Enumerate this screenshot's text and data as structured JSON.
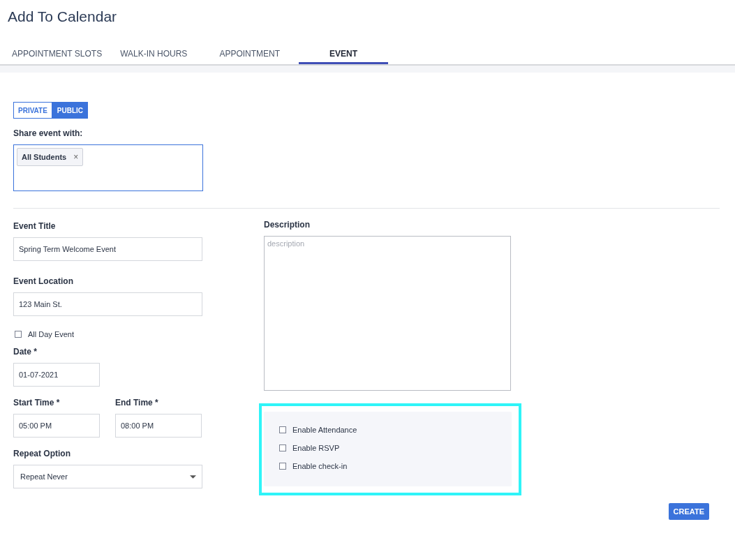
{
  "page_title": "Add To Calendar",
  "tabs": [
    {
      "label": "APPOINTMENT SLOTS",
      "selected": false
    },
    {
      "label": "WALK-IN HOURS",
      "selected": false
    },
    {
      "label": "APPOINTMENT",
      "selected": false
    },
    {
      "label": "EVENT",
      "selected": true
    }
  ],
  "visibility": [
    {
      "label": "PRIVATE",
      "selected": false
    },
    {
      "label": "PUBLIC",
      "selected": true
    }
  ],
  "share": {
    "label": "Share event with:",
    "chips": [
      {
        "label": "All Students",
        "remove": "×"
      }
    ]
  },
  "event_title": {
    "label": "Event Title",
    "value": "Spring Term Welcome Event"
  },
  "event_location": {
    "label": "Event Location",
    "value": "123 Main St."
  },
  "all_day": {
    "label": "All Day Event",
    "checked": false
  },
  "date": {
    "label": "Date *",
    "value": "01-07-2021"
  },
  "start_time": {
    "label": "Start Time *",
    "value": "05:00 PM"
  },
  "end_time": {
    "label": "End Time *",
    "value": "08:00 PM"
  },
  "repeat": {
    "label": "Repeat Option",
    "value": "Repeat Never"
  },
  "description": {
    "label": "Description",
    "placeholder": "description"
  },
  "options": [
    {
      "label": "Enable Attendance",
      "checked": false
    },
    {
      "label": "Enable RSVP",
      "checked": false
    },
    {
      "label": "Enable check-in",
      "checked": false
    }
  ],
  "create_button": "CREATE"
}
